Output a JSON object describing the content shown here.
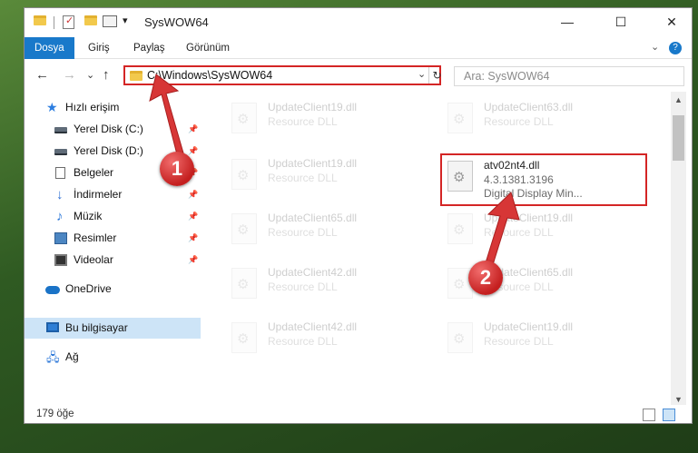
{
  "window": {
    "title": "SysWOW64",
    "controls": {
      "minimize": "—",
      "maximize": "☐",
      "close": "✕"
    }
  },
  "ribbon": {
    "tabs": [
      "Dosya",
      "Giriş",
      "Paylaş",
      "Görünüm"
    ],
    "help": "?",
    "collapse": "⌄"
  },
  "nav": {
    "back": "←",
    "forward": "→",
    "recent": "⌄",
    "up": "↑",
    "address": "C:\\Windows\\SysWOW64",
    "address_dropdown": "⌄",
    "refresh": "↻",
    "search_placeholder": "Ara: SysWOW64"
  },
  "sidebar": {
    "items": [
      {
        "label": "Hızlı erişim",
        "icon": "star-icon"
      },
      {
        "label": "Yerel Disk (C:)",
        "icon": "drive-icon",
        "pinned": true
      },
      {
        "label": "Yerel Disk (D:)",
        "icon": "drive-icon",
        "pinned": true
      },
      {
        "label": "Belgeler",
        "icon": "document-icon",
        "pinned": true
      },
      {
        "label": "İndirmeler",
        "icon": "download-icon",
        "pinned": true
      },
      {
        "label": "Müzik",
        "icon": "music-icon",
        "pinned": true
      },
      {
        "label": "Resimler",
        "icon": "pictures-icon",
        "pinned": true
      },
      {
        "label": "Videolar",
        "icon": "videos-icon",
        "pinned": true
      },
      {
        "label": "OneDrive",
        "icon": "cloud-icon"
      },
      {
        "label": "Bu bilgisayar",
        "icon": "computer-icon",
        "selected": true
      },
      {
        "label": "Ağ",
        "icon": "network-icon"
      }
    ],
    "pin_glyph": "📌"
  },
  "files": {
    "left": [
      {
        "name": "UpdateClient19.dll",
        "type": "Resource DLL"
      },
      {
        "name": "UpdateClient19.dll",
        "type": "Resource DLL"
      },
      {
        "name": "UpdateClient65.dll",
        "type": "Resource DLL"
      },
      {
        "name": "UpdateClient42.dll",
        "type": "Resource DLL"
      },
      {
        "name": "UpdateClient42.dll",
        "type": "Resource DLL"
      }
    ],
    "right": [
      {
        "name": "UpdateClient63.dll",
        "type": "Resource DLL"
      },
      {
        "name": "UpdateClient19.dll",
        "type": "Resource DLL"
      },
      {
        "name": "UpdateClient65.dll",
        "type": "Resource DLL"
      },
      {
        "name": "UpdateClient19.dll",
        "type": "Resource DLL"
      }
    ],
    "highlighted": {
      "name": "atv02nt4.dll",
      "version": "4.3.1381.3196",
      "description": "Digital Display Min..."
    }
  },
  "status": {
    "count": "179 öğe"
  },
  "annotations": {
    "callout1": "1",
    "callout2": "2"
  },
  "colors": {
    "accent": "#1979ca",
    "annotation": "#d42525",
    "selection": "#cde4f7"
  }
}
